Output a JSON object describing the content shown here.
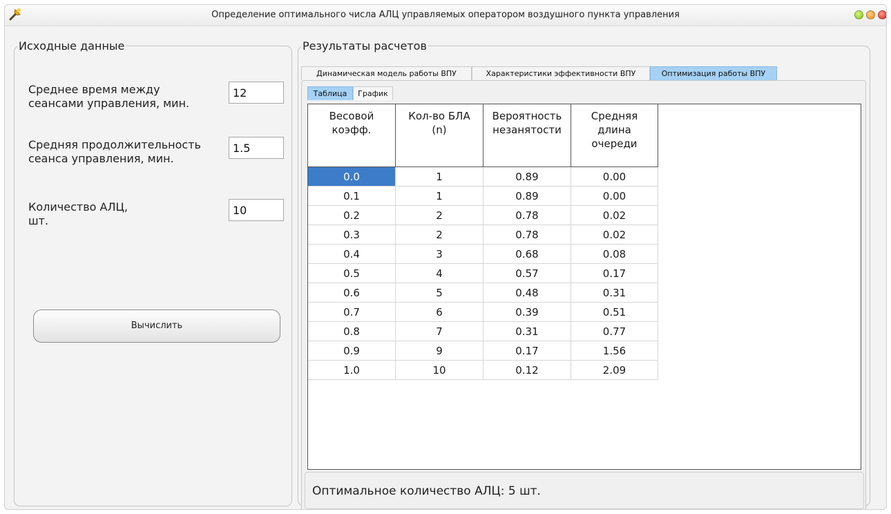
{
  "window": {
    "title": "Определение оптимального числа АЛЦ управляемых оператором воздушного пункта управления",
    "app_icon": "bulb-icon",
    "controls": [
      {
        "name": "minimize",
        "color": "#7fc21a"
      },
      {
        "name": "maximize",
        "color": "#f08a14"
      },
      {
        "name": "close",
        "color": "#d8281a"
      }
    ]
  },
  "input_panel": {
    "title": "Исходные данные",
    "fields": [
      {
        "label_line1": "Среднее время между",
        "label_line2": "сеансами управления, мин.",
        "value": "12"
      },
      {
        "label_line1": "Средняя продолжительность",
        "label_line2": "сеанса управления, мин.",
        "value": "1.5"
      },
      {
        "label_line1": "Количество АЛЦ,",
        "label_line2": "шт.",
        "value": "10"
      }
    ],
    "calculate_button": "Вычислить"
  },
  "results_panel": {
    "title": "Результаты расчетов",
    "tabs": [
      {
        "label": "Динамическая модель работы ВПУ",
        "active": false
      },
      {
        "label": "Характеристики эффективности ВПУ",
        "active": false
      },
      {
        "label": "Оптимизация работы ВПУ",
        "active": true
      }
    ],
    "subtabs": [
      {
        "label": "Таблица",
        "active": true
      },
      {
        "label": "График",
        "active": false
      }
    ],
    "table": {
      "columns": [
        {
          "line1": "Весовой",
          "line2": "коэфф.",
          "line3": ""
        },
        {
          "line1": "Кол-во БЛА",
          "line2": "(n)",
          "line3": ""
        },
        {
          "line1": "Вероятность",
          "line2": "незанятости",
          "line3": ""
        },
        {
          "line1": "Средняя",
          "line2": "длина",
          "line3": "очереди"
        }
      ],
      "rows": [
        [
          "0.0",
          "1",
          "0.89",
          "0.00"
        ],
        [
          "0.1",
          "1",
          "0.89",
          "0.00"
        ],
        [
          "0.2",
          "2",
          "0.78",
          "0.02"
        ],
        [
          "0.3",
          "2",
          "0.78",
          "0.02"
        ],
        [
          "0.4",
          "3",
          "0.68",
          "0.08"
        ],
        [
          "0.5",
          "4",
          "0.57",
          "0.17"
        ],
        [
          "0.6",
          "5",
          "0.48",
          "0.31"
        ],
        [
          "0.7",
          "6",
          "0.39",
          "0.51"
        ],
        [
          "0.8",
          "7",
          "0.31",
          "0.77"
        ],
        [
          "0.9",
          "9",
          "0.17",
          "1.56"
        ],
        [
          "1.0",
          "10",
          "0.12",
          "2.09"
        ]
      ],
      "selected_cell": "0.0"
    },
    "status": "Оптимальное количество АЛЦ: 5 шт."
  },
  "colors": {
    "accent": "#a5d1f5",
    "selection": "#3d7cc9",
    "window_bg": "#f3f3f3"
  }
}
